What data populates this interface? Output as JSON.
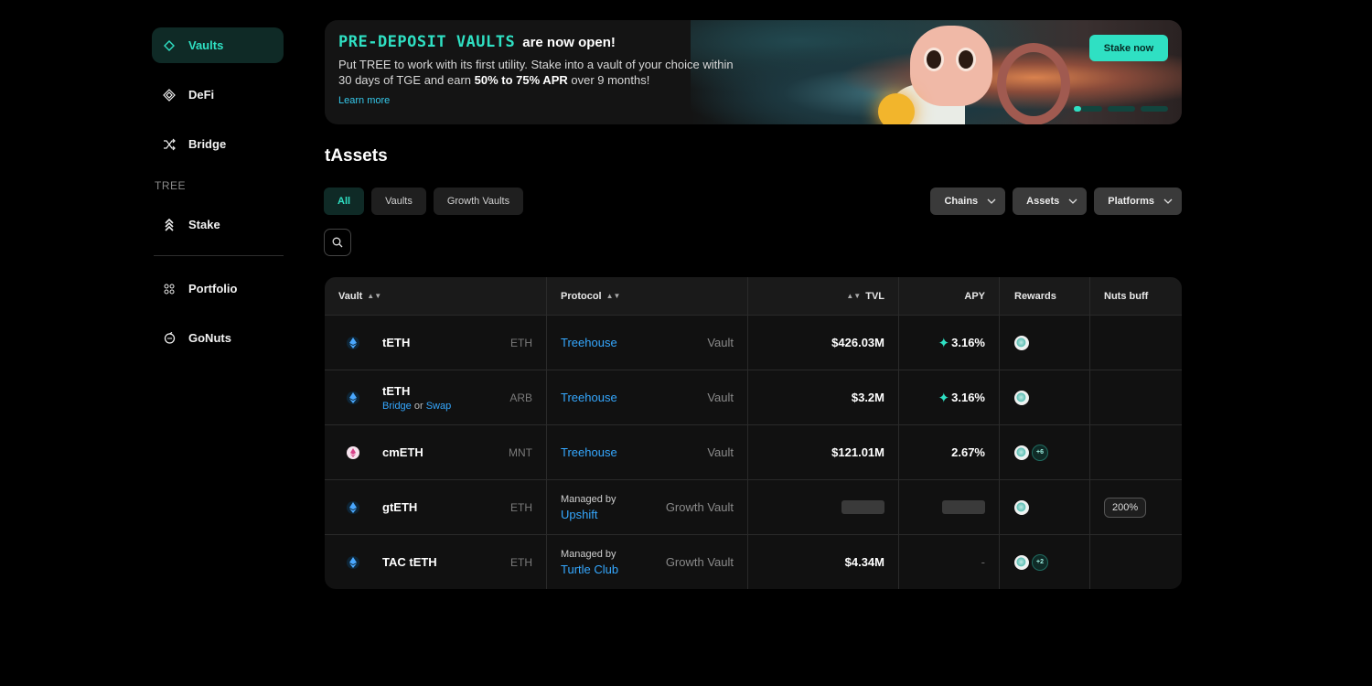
{
  "sidebar": {
    "items": [
      {
        "label": "Vaults",
        "icon": "diamond-icon",
        "active": true
      },
      {
        "label": "DeFi",
        "icon": "defi-icon"
      },
      {
        "label": "Bridge",
        "icon": "shuffle-icon"
      }
    ],
    "section_label": "TREE",
    "tree_items": [
      {
        "label": "Stake",
        "icon": "stake-icon"
      }
    ],
    "bottom_items": [
      {
        "label": "Portfolio",
        "icon": "grid-icon"
      },
      {
        "label": "GoNuts",
        "icon": "nut-icon"
      }
    ]
  },
  "banner": {
    "highlight": "PRE-DEPOSIT VAULTS",
    "title_rest": "are now open!",
    "text_1": "Put TREE to work with its first utility. Stake into a vault of your choice within 30 days of TGE and earn ",
    "text_bold": "50% to 75% APR",
    "text_2": " over 9 months!",
    "link": "Learn more",
    "cta": "Stake now",
    "accent": "#2fe0c3"
  },
  "main": {
    "title": "tAssets",
    "tabs": [
      "All",
      "Vaults",
      "Growth Vaults"
    ],
    "filters": [
      "Chains",
      "Assets",
      "Platforms"
    ]
  },
  "table": {
    "headers": {
      "vault": "Vault",
      "protocol": "Protocol",
      "tvl": "TVL",
      "apy": "APY",
      "rewards": "Rewards",
      "nuts": "Nuts buff"
    },
    "rows": [
      {
        "vault": "tETH",
        "chain": "ETH",
        "protocol": "Treehouse",
        "type": "Vault",
        "tvl": "$426.03M",
        "apy": "3.16%",
        "extra_rewards": ""
      },
      {
        "vault": "tETH",
        "bridge": "Bridge",
        "or": "or",
        "swap": "Swap",
        "chain": "ARB",
        "protocol": "Treehouse",
        "type": "Vault",
        "tvl": "$3.2M",
        "apy": "3.16%"
      },
      {
        "vault": "cmETH",
        "chain": "MNT",
        "protocol": "Treehouse",
        "type": "Vault",
        "tvl": "$121.01M",
        "apy": "2.67%",
        "extra_rewards": "+6"
      },
      {
        "vault": "gtETH",
        "chain": "ETH",
        "managed": "Managed by",
        "protocol": "Upshift",
        "type": "Growth Vault",
        "buff": "200%"
      },
      {
        "vault": "TAC tETH",
        "chain": "ETH",
        "managed": "Managed by",
        "protocol": "Turtle Club",
        "type": "Growth Vault",
        "tvl": "$4.34M",
        "apy": "-",
        "extra_rewards": "+2"
      }
    ]
  }
}
